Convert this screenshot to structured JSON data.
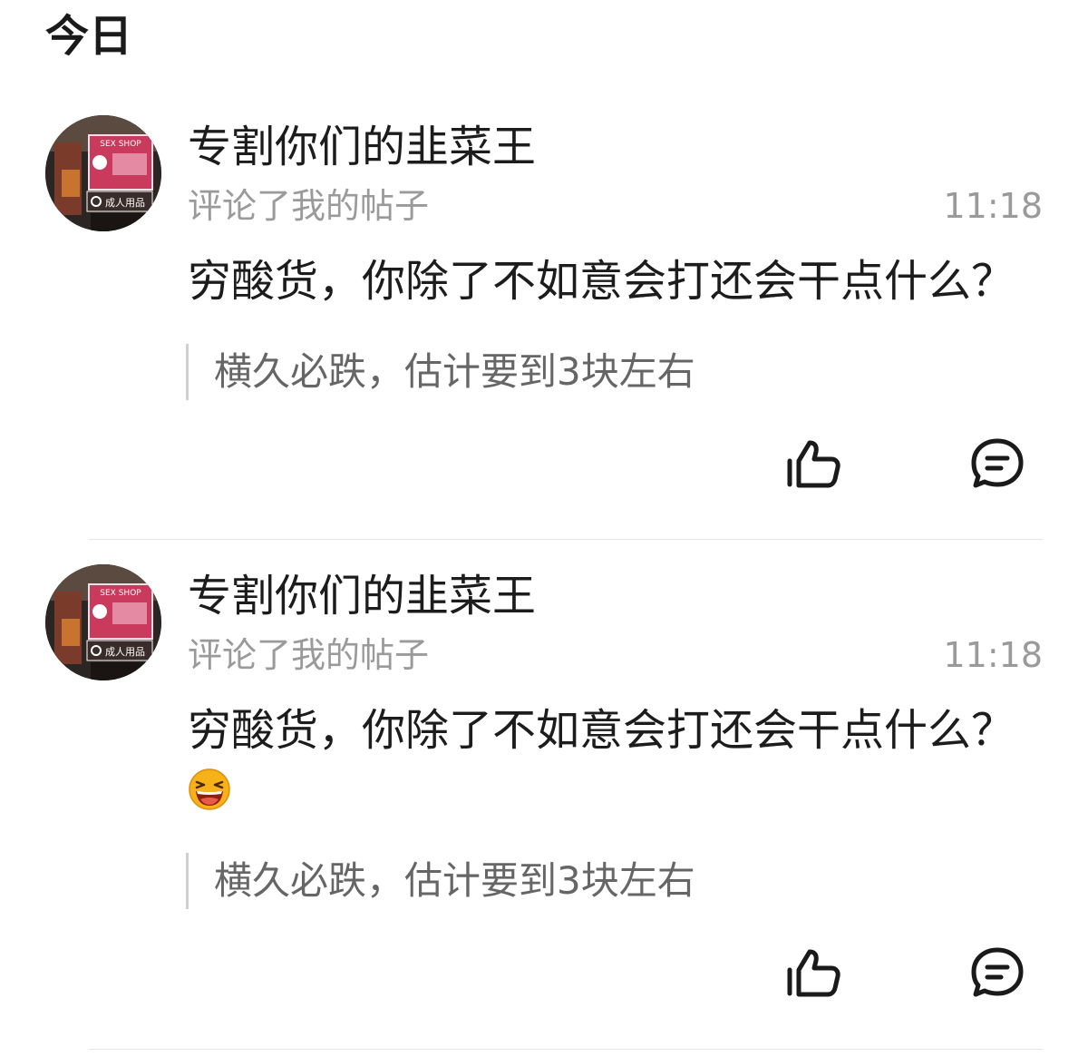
{
  "section": {
    "title": "今日"
  },
  "notifications": [
    {
      "user": "专割你们的韭菜王",
      "action": "评论了我的帖子",
      "time": "11:18",
      "comment": "穷酸货，你除了不如意会打还会干点什么？",
      "has_emoji": false,
      "quote": "横久必跌，估计要到3块左右",
      "avatar_sign": {
        "top": "SEX SHOP",
        "bottom": "成人用品"
      }
    },
    {
      "user": "专割你们的韭菜王",
      "action": "评论了我的帖子",
      "time": "11:18",
      "comment": "穷酸货，你除了不如意会打还会干点什么？",
      "has_emoji": true,
      "emoji": "laughing-emoji",
      "quote": "横久必跌，估计要到3块左右",
      "avatar_sign": {
        "top": "SEX SHOP",
        "bottom": "成人用品"
      }
    }
  ],
  "icons": {
    "like": "thumbs-up-icon",
    "reply": "comment-bubble-icon"
  },
  "colors": {
    "text": "#1c1c1c",
    "secondary": "#9a9a9a",
    "quote_text": "#666666",
    "quote_bar": "#cfcfcf",
    "divider": "#e6e6e6",
    "sign_pink": "#d6456a",
    "emoji_yellow": "#f7b21a"
  }
}
